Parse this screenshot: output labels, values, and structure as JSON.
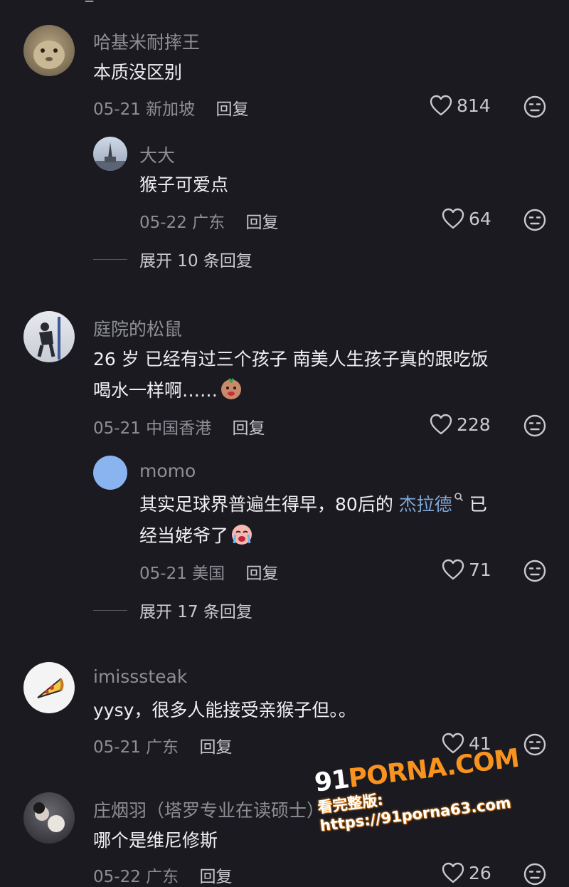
{
  "top_fragment": "_",
  "comments": [
    {
      "user": "哈基米耐摔王",
      "text": "本质没区别",
      "date": "05-21",
      "location": "新加坡",
      "reply_label": "回复",
      "likes": "814",
      "replies": [
        {
          "user": "大大",
          "text": "猴子可爱点",
          "date": "05-22",
          "location": "广东",
          "reply_label": "回复",
          "likes": "64"
        }
      ],
      "expand_label": "展开 10 条回复"
    },
    {
      "user": "庭院的松鼠",
      "text_line1": "26 岁 已经有过三个孩子 南美人生孩子真的跟吃饭",
      "text_line2": "喝水一样啊……",
      "date": "05-21",
      "location": "中国香港",
      "reply_label": "回复",
      "likes": "228",
      "replies": [
        {
          "user": "momo",
          "text_line1_pre": "其实足球界普遍生得早，80后的 ",
          "text_link": "杰拉德",
          "text_line1_post": " 已",
          "text_line2": "经当姥爷了",
          "date": "05-21",
          "location": "美国",
          "reply_label": "回复",
          "likes": "71"
        }
      ],
      "expand_label": "展开 17 条回复"
    },
    {
      "user": "imisssteak",
      "text": "yysy，很多人能接受亲猴子但。。",
      "date": "05-21",
      "location": "广东",
      "reply_label": "回复",
      "likes": "41"
    },
    {
      "user": "庄烟羽（塔罗专业在读硕士）",
      "text": "哪个是维尼修斯",
      "date": "05-22",
      "location": "广东",
      "reply_label": "回复",
      "likes": "26"
    }
  ],
  "watermark": {
    "line1_num": "91",
    "line1_text": "PORNA.COM",
    "line2": "看完整版: https://91porna63.com"
  },
  "colors": {
    "background": "#1a1a20",
    "username": "#8e8e95",
    "link": "#7fa7d8",
    "watermark_orange": "#f7931e"
  }
}
